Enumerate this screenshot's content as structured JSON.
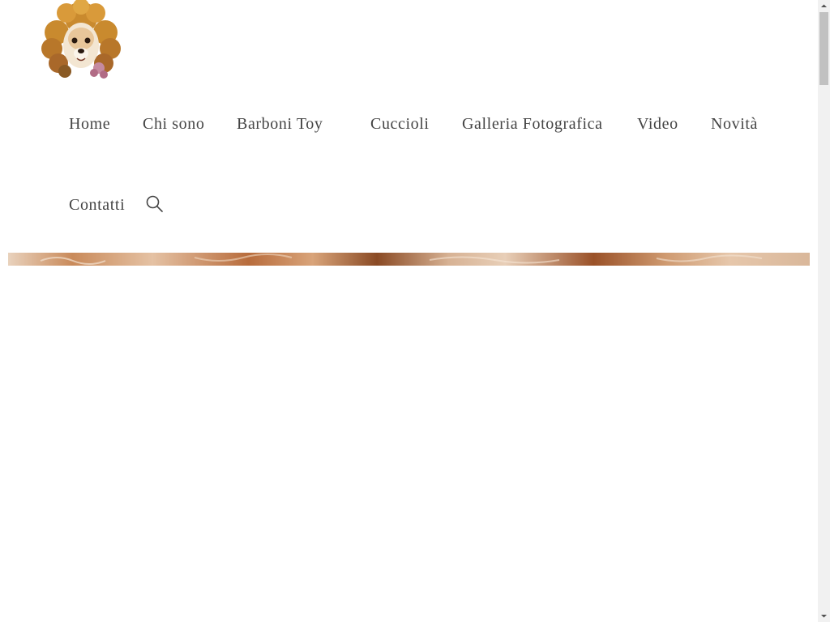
{
  "header": {
    "logo_icon": "poodle-logo-icon"
  },
  "nav": {
    "items": [
      {
        "label": "Home"
      },
      {
        "label": "Chi sono"
      },
      {
        "label": "Barboni Toy"
      },
      {
        "label": "Cuccioli"
      },
      {
        "label": "Galleria Fotografica"
      },
      {
        "label": "Video"
      },
      {
        "label": "Novità"
      },
      {
        "label": "Contatti"
      }
    ],
    "search_icon": "search-icon"
  },
  "colors": {
    "nav_text": "#444444",
    "background": "#ffffff",
    "scrollbar_track": "#f1f1f1",
    "scrollbar_thumb": "#c1c1c1"
  }
}
